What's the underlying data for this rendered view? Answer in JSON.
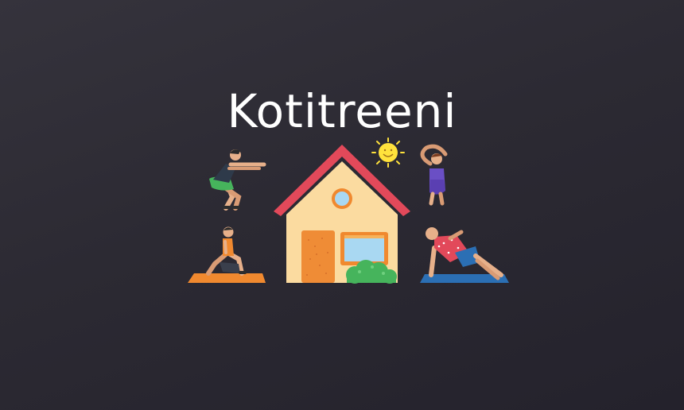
{
  "banner": {
    "title": "Kotitreeni"
  },
  "illustration": {
    "house_roof_color": "#e2495a",
    "house_wall_color": "#fbdba0",
    "door_color": "#ef8c36",
    "sun_color": "#ffe23c",
    "mat_left_color": "#f0892f",
    "mat_right_color": "#2b6fb4",
    "bush_color": "#46b45c"
  }
}
